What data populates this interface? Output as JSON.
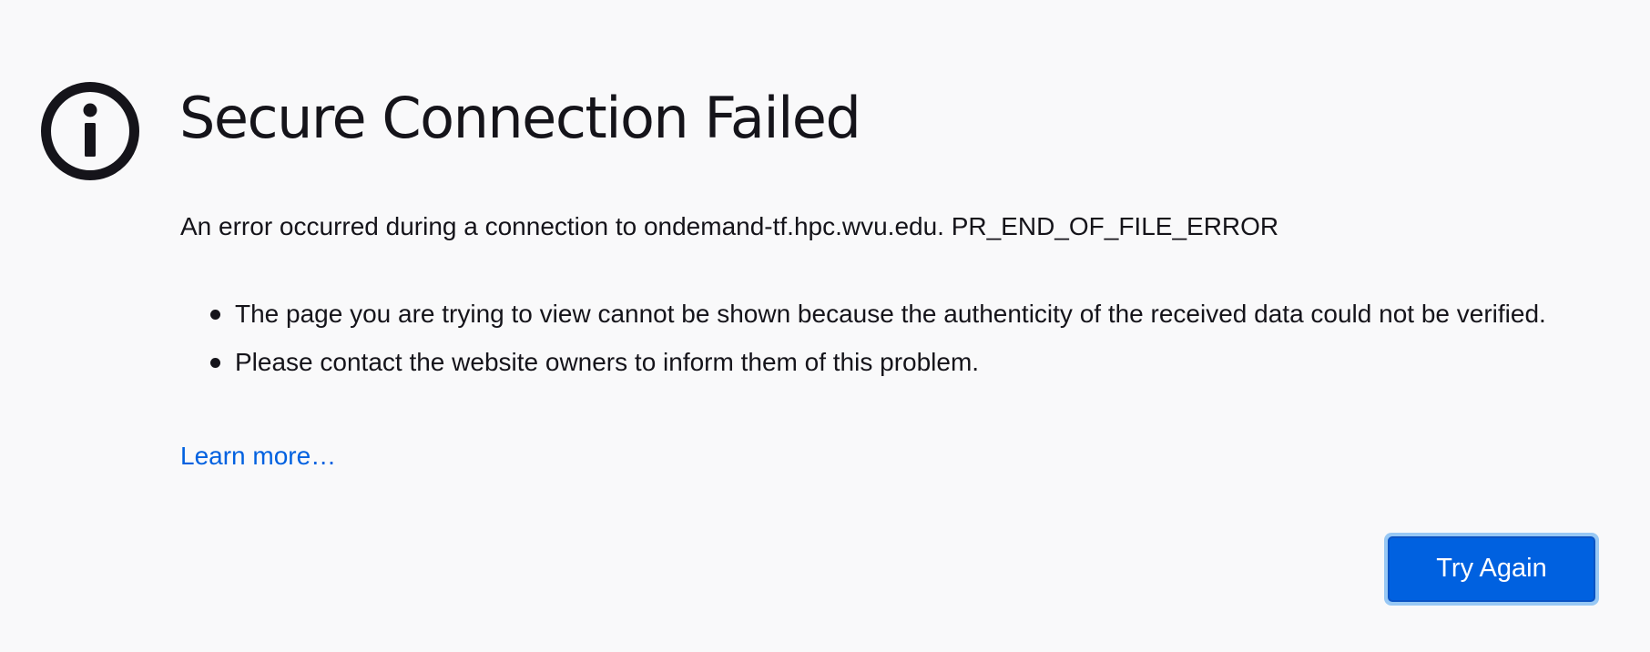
{
  "page": {
    "title": "Secure Connection Failed",
    "icon": "info-icon",
    "description": "An error occurred during a connection to ondemand-tf.hpc.wvu.edu. PR_END_OF_FILE_ERROR",
    "bullets": [
      "The page you are trying to view cannot be shown because the authenticity of the received data could not be verified.",
      "Please contact the website owners to inform them of this problem."
    ],
    "learn_more": "Learn more…",
    "try_again": "Try Again"
  },
  "colors": {
    "background": "#f9f9fa",
    "text": "#15141a",
    "link": "#0061e0",
    "button": "#0061e0",
    "button_focus_ring": "#98c8f4"
  }
}
